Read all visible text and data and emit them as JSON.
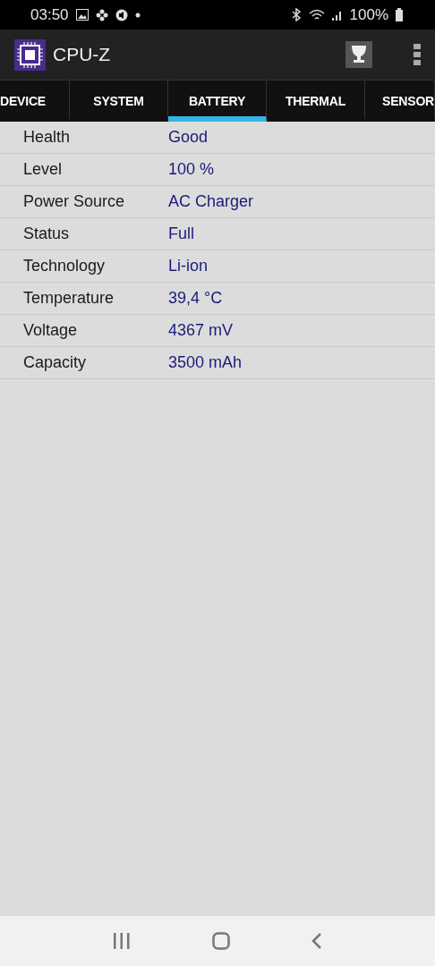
{
  "status_bar": {
    "time": "03:50",
    "battery": "100%"
  },
  "app_bar": {
    "title": "CPU-Z"
  },
  "tabs": [
    {
      "label": "DEVICE",
      "selected": false
    },
    {
      "label": "SYSTEM",
      "selected": false
    },
    {
      "label": "BATTERY",
      "selected": true
    },
    {
      "label": "THERMAL",
      "selected": false
    },
    {
      "label": "SENSOR",
      "selected": false
    }
  ],
  "rows": [
    {
      "label": "Health",
      "value": "Good"
    },
    {
      "label": "Level",
      "value": "100 %"
    },
    {
      "label": "Power Source",
      "value": "AC Charger"
    },
    {
      "label": "Status",
      "value": "Full"
    },
    {
      "label": "Technology",
      "value": "Li-ion"
    },
    {
      "label": "Temperature",
      "value": "39,4 °C"
    },
    {
      "label": "Voltage",
      "value": "4367 mV"
    },
    {
      "label": "Capacity",
      "value": "3500 mAh"
    }
  ]
}
